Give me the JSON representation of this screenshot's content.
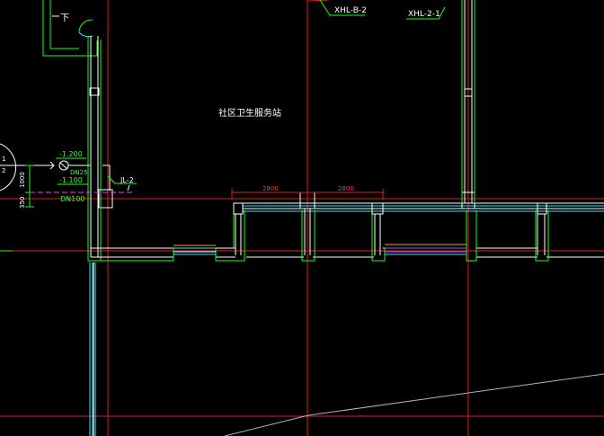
{
  "title": "",
  "labels": {
    "room_name": "社区卫生服务站",
    "tag_xhl_b2": "XHL-B-2",
    "tag_xhl_21": "XHL-2-1",
    "tag_jl2": "JL-2",
    "elev_top": "-1.200",
    "elev_bottom": "-1.100",
    "pipe_dn25": "DN25",
    "pipe_dn100": "DN100",
    "dim_2800_left": "2800",
    "dim_2800_right": "2800",
    "dim_1000": "1000",
    "dim_350": "350",
    "valve_mark": "下",
    "left_marks": [
      "1",
      "2"
    ]
  },
  "colors": {
    "background": "#000000",
    "grid": "#e01e1e",
    "wall": "#ffffff",
    "wall_outline": "#17ff17",
    "cyan": "#33e6ff",
    "pipe_dash": "#ff33ff",
    "window_orange": "#ff9a2e",
    "window_blue": "#5a7dff",
    "text_white": "#ffffff",
    "text_green": "#2cff2c",
    "text_red": "#ff3a3a",
    "gray": "#b4b4b4"
  }
}
